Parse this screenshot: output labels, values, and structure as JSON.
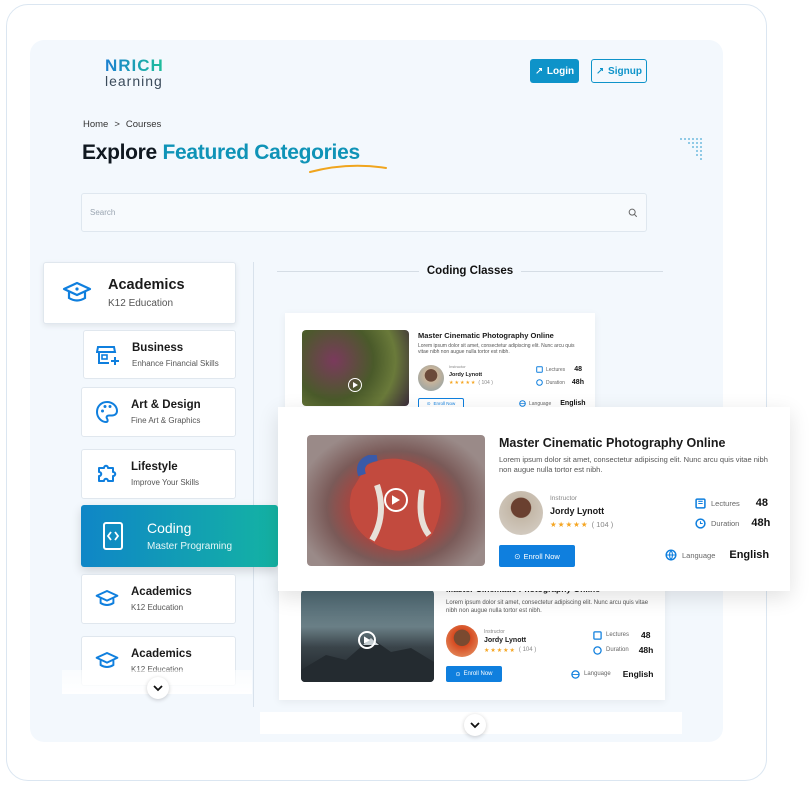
{
  "brand": {
    "line1": "NRICH",
    "line2": "learning"
  },
  "header": {
    "login": "Login",
    "signup": "Signup"
  },
  "breadcrumb": {
    "home": "Home",
    "sep": ">",
    "current": "Courses"
  },
  "page_title": {
    "part1": "Explore",
    "part2": "Featured Categories"
  },
  "search": {
    "placeholder": "Search"
  },
  "categories": [
    {
      "title": "Academics",
      "subtitle": "K12 Education",
      "icon": "graduation-cap-icon"
    },
    {
      "title": "Business",
      "subtitle": "Enhance Financial Skills",
      "icon": "store-plus-icon"
    },
    {
      "title": "Art & Design",
      "subtitle": "Fine Art & Graphics",
      "icon": "palette-icon"
    },
    {
      "title": "Lifestyle",
      "subtitle": "Improve Your Skills",
      "icon": "puzzle-icon"
    },
    {
      "title": "Coding",
      "subtitle": "Master Programing",
      "icon": "code-icon"
    },
    {
      "title": "Academics",
      "subtitle": "K12 Education",
      "icon": "graduation-cap-icon"
    },
    {
      "title": "Academics",
      "subtitle": "K12 Education",
      "icon": "graduation-cap-icon"
    }
  ],
  "section_title": "Coding Classes",
  "courses": [
    {
      "title": "Master Cinematic Photography Online",
      "description": "Lorem ipsum dolor sit amet, consectetur adipiscing elit. Nunc arcu quis vitae nibh non augue nulla tortor est nibh.",
      "instructor_label": "Instructor",
      "instructor": "Jordy Lynott",
      "rating": 4,
      "reviews": "( 104 )",
      "lectures_label": "Lectures",
      "lectures": "48",
      "duration_label": "Duration",
      "duration": "48h",
      "language_label": "Language",
      "language": "English",
      "enroll": "Enroll Now"
    },
    {
      "title": "Master Cinematic Photography Online",
      "description": "Lorem ipsum dolor sit amet, consectetur adipiscing elit. Nunc arcu quis vitae nibh non augue nulla tortor est nibh.",
      "instructor_label": "Instructor",
      "instructor": "Jordy Lynott",
      "rating": 4,
      "reviews": "( 104 )",
      "lectures_label": "Lectures",
      "lectures": "48",
      "duration_label": "Duration",
      "duration": "48h",
      "language_label": "Language",
      "language": "English",
      "enroll": "Enroll Now"
    },
    {
      "title": "Master Cinematic Photography Online",
      "description": "Lorem ipsum dolor sit amet, consectetur adipiscing elit. Nunc arcu quis vitae nibh non augue nulla tortor est nibh.",
      "instructor_label": "Instructor",
      "instructor": "Jordy Lynott",
      "rating": 4,
      "reviews": "( 104 )",
      "lectures_label": "Lectures",
      "lectures": "48",
      "duration_label": "Duration",
      "duration": "48h",
      "language_label": "Language",
      "language": "English",
      "enroll": "Enroll Now"
    }
  ],
  "colors": {
    "primary": "#0e93c9",
    "accent": "#0f93b7",
    "gradient_start": "#0f86c7",
    "gradient_end": "#14b3a3",
    "enroll_blue": "#0f7fde",
    "star": "#f5a623"
  },
  "icons": {
    "scroll_down": "chevron-down-icon",
    "search": "search-icon"
  }
}
